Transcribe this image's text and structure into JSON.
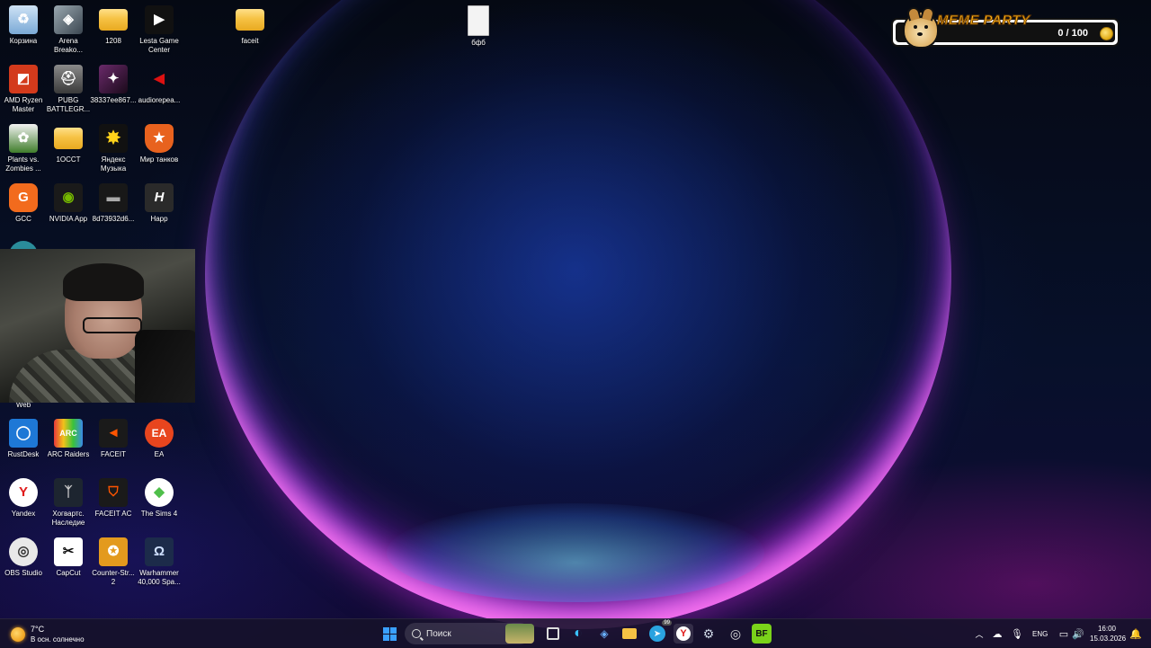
{
  "desktop_icons": [
    {
      "label": "Корзина",
      "icon": "recycle-bin-icon",
      "color": "#4a90d9"
    },
    {
      "label": "Arena Breako...",
      "icon": "arena-breakout-icon",
      "color": "#6b7a85"
    },
    {
      "label": "1208",
      "icon": "folder-icon",
      "color": "#f6c244"
    },
    {
      "label": "Lesta Game Center",
      "icon": "lesta-icon",
      "color": "#111111"
    },
    {
      "label": "faceit",
      "icon": "folder-icon",
      "color": "#f6c244"
    },
    {
      "label": "бфб",
      "icon": "document-icon",
      "color": "#f3f3f3"
    },
    {
      "label": "AMD Ryzen Master",
      "icon": "amd-icon",
      "color": "#d33a1c"
    },
    {
      "label": "PUBG BATTLEGR...",
      "icon": "pubg-icon",
      "color": "#555555"
    },
    {
      "label": "38337ee867...",
      "icon": "image-file-icon",
      "color": "#6a2a6a"
    },
    {
      "label": "audiorepea...",
      "icon": "audio-icon",
      "color": "#b11616"
    },
    {
      "label": "Plants vs. Zombies ...",
      "icon": "pvz-icon",
      "color": "#3f7d2a"
    },
    {
      "label": "1OCCT",
      "icon": "folder-icon",
      "color": "#f6c244"
    },
    {
      "label": "Яндекс Музыка",
      "icon": "yandex-music-icon",
      "color": "#1a1a1a"
    },
    {
      "label": "Мир танков",
      "icon": "mir-tankov-icon",
      "color": "#e8621e"
    },
    {
      "label": "GCC",
      "icon": "gcc-icon",
      "color": "#f26b1d"
    },
    {
      "label": "NVIDIA App",
      "icon": "nvidia-icon",
      "color": "#3a7a1a"
    },
    {
      "label": "8d73932d6...",
      "icon": "image-file-icon",
      "color": "#222222"
    },
    {
      "label": "Happ",
      "icon": "happ-icon",
      "color": "#2a2a2a"
    },
    {
      "label": "Web",
      "icon": "web-icon",
      "color": "#2a8c9a"
    },
    {
      "label": "RustDesk",
      "icon": "rustdesk-icon",
      "color": "#1e78d6"
    },
    {
      "label": "ARC Raiders",
      "icon": "arc-raiders-icon",
      "color": "#1b1b1b"
    },
    {
      "label": "FACEIT",
      "icon": "faceit-icon",
      "color": "#1a1a1a"
    },
    {
      "label": "EA",
      "icon": "ea-icon",
      "color": "#e8451e"
    },
    {
      "label": "Yandex",
      "icon": "yandex-browser-icon",
      "color": "#ffffff"
    },
    {
      "label": "Хогвартс. Наследие",
      "icon": "hogwarts-icon",
      "color": "#1d2530"
    },
    {
      "label": "FACEIT AC",
      "icon": "faceit-ac-icon",
      "color": "#1a1a1a"
    },
    {
      "label": "The Sims 4",
      "icon": "sims-icon",
      "color": "#4fbf4a"
    },
    {
      "label": "OBS Studio",
      "icon": "obs-icon",
      "color": "#333333"
    },
    {
      "label": "CapCut",
      "icon": "capcut-icon",
      "color": "#ffffff"
    },
    {
      "label": "Counter-Str... 2",
      "icon": "cs2-icon",
      "color": "#e39a1e"
    },
    {
      "label": "Warhammer 40,000 Spa...",
      "icon": "warhammer-icon",
      "color": "#1c2b4a"
    }
  ],
  "meme_party": {
    "title": "MEME PARTY",
    "score": "0 / 100"
  },
  "taskbar": {
    "weather_temp": "7°C",
    "weather_desc": "В осн. солнечно",
    "search_placeholder": "Поиск",
    "telegram_badge": "99",
    "language": "ENG",
    "time": "16:00",
    "date": "15.03.2026"
  },
  "colors": {
    "taskbar_bg": "#16122a",
    "accent_blue": "#3aa0ff",
    "meme_title": "#ffb81c"
  }
}
